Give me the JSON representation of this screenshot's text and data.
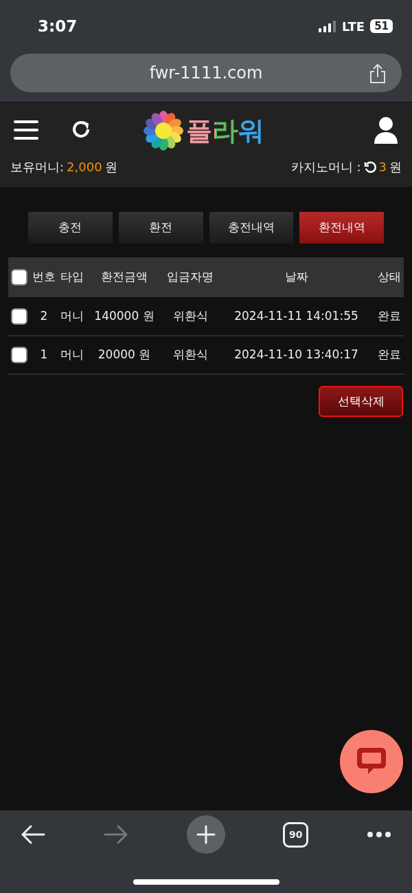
{
  "status_bar": {
    "time": "3:07",
    "network": "LTE",
    "battery": "51"
  },
  "browser": {
    "url": "fwr-1111.com",
    "tab_count": "90"
  },
  "site_header": {
    "logo_text": "플라워"
  },
  "balances": [
    {
      "label": "보유머니:",
      "value": "2,000",
      "unit": "원",
      "kind": "plain"
    },
    {
      "label": "카지노머니 :",
      "value": "3",
      "unit": "원",
      "kind": "refreshable"
    }
  ],
  "tabs": [
    {
      "label": "충전",
      "selected": false
    },
    {
      "label": "환전",
      "selected": false
    },
    {
      "label": "충전내역",
      "selected": false
    },
    {
      "label": "환전내역",
      "selected": true
    }
  ],
  "table": {
    "select_all_checked": false,
    "columns": [
      "번호",
      "타입",
      "환전금액",
      "입금자명",
      "날짜",
      "상태"
    ],
    "rows": [
      {
        "checked": false,
        "cells": [
          "2",
          "머니",
          "140000 원",
          "위환식",
          "2024-11-11 14:01:55",
          "완료"
        ]
      },
      {
        "checked": false,
        "cells": [
          "1",
          "머니",
          "20000 원",
          "위환식",
          "2024-11-10 13:40:17",
          "완료"
        ]
      }
    ]
  },
  "delete_button": "선택삭제"
}
